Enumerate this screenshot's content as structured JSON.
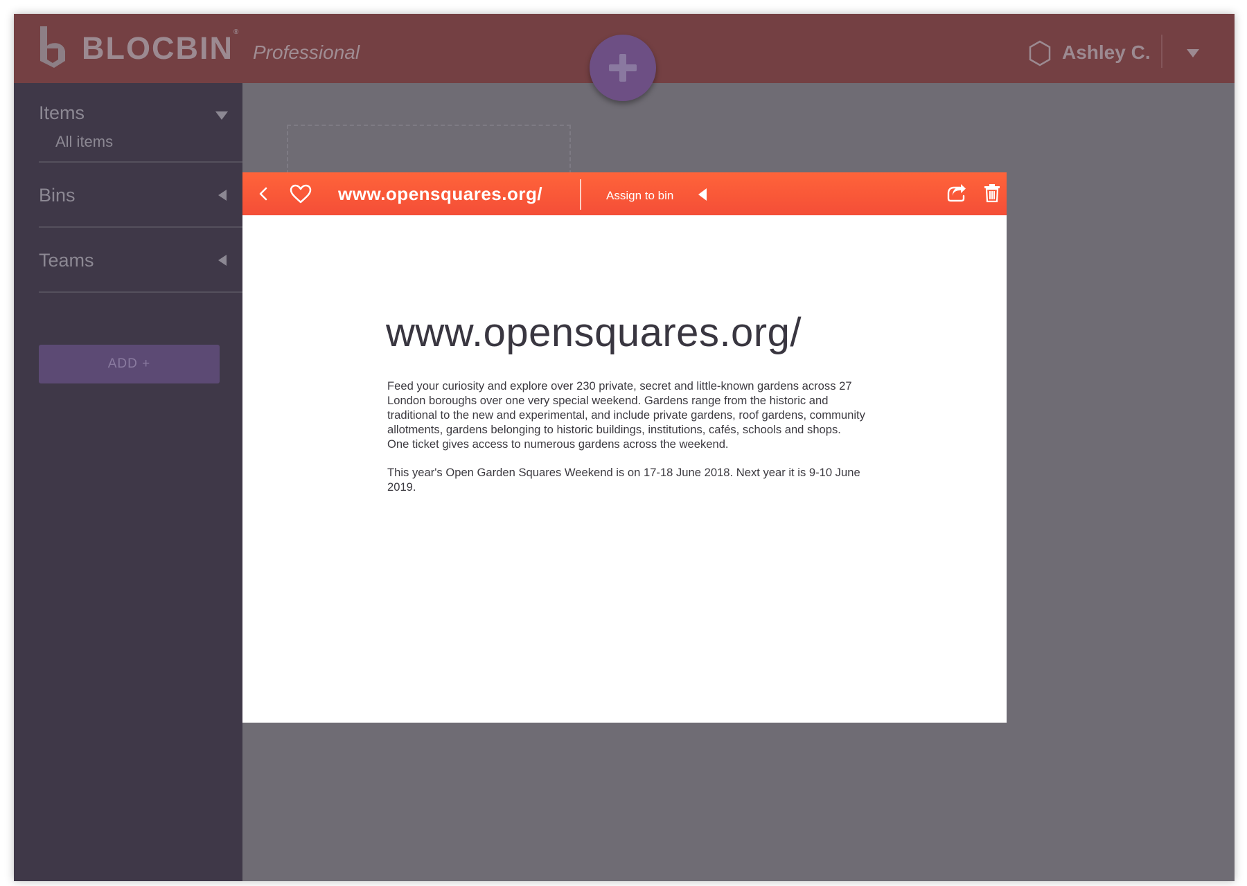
{
  "header": {
    "brand": "BLOCBIN",
    "registered_mark": "®",
    "edition": "Professional",
    "user_name": "Ashley C."
  },
  "sidebar": {
    "sections": [
      {
        "label": "Items",
        "expanded": true,
        "children": [
          "All items"
        ]
      },
      {
        "label": "Bins",
        "expanded": false,
        "children": []
      },
      {
        "label": "Teams",
        "expanded": false,
        "children": []
      }
    ],
    "add_button_label": "ADD +"
  },
  "modal": {
    "toolbar": {
      "url": "www.opensquares.org/",
      "assign_label": "Assign to bin"
    },
    "content": {
      "title": "www.opensquares.org/",
      "paragraphs": [
        "Feed your curiosity and explore over 230 private, secret and little-known gardens across 27 London boroughs over one very special weekend. Gardens range from the historic and traditional to the new and experimental, and include private gardens, roof gardens, community allotments, gardens belonging to historic buildings, institutions, cafés, schools and shops. One ticket gives access to numerous gardens across the weekend.",
        "This year's Open Garden Squares Weekend is on 17-18 June 2018. Next year it is 9-10 June 2019."
      ]
    }
  },
  "colors": {
    "topbar": "#744043",
    "sidebar": "#3f3848",
    "main_overlay": "#6f6c74",
    "accent_orange": "#f4553a",
    "fab_purple": "#6d4f84",
    "add_button": "#5c4a74"
  },
  "icons": {
    "logo": "blocbin-logo-icon",
    "fab": "plus-icon",
    "user": "hexagon-user-icon",
    "user_menu": "caret-down-icon",
    "back": "chevron-left-icon",
    "favorite": "heart-icon",
    "assign_caret": "caret-left-icon",
    "share": "share-icon",
    "delete": "trash-icon"
  }
}
